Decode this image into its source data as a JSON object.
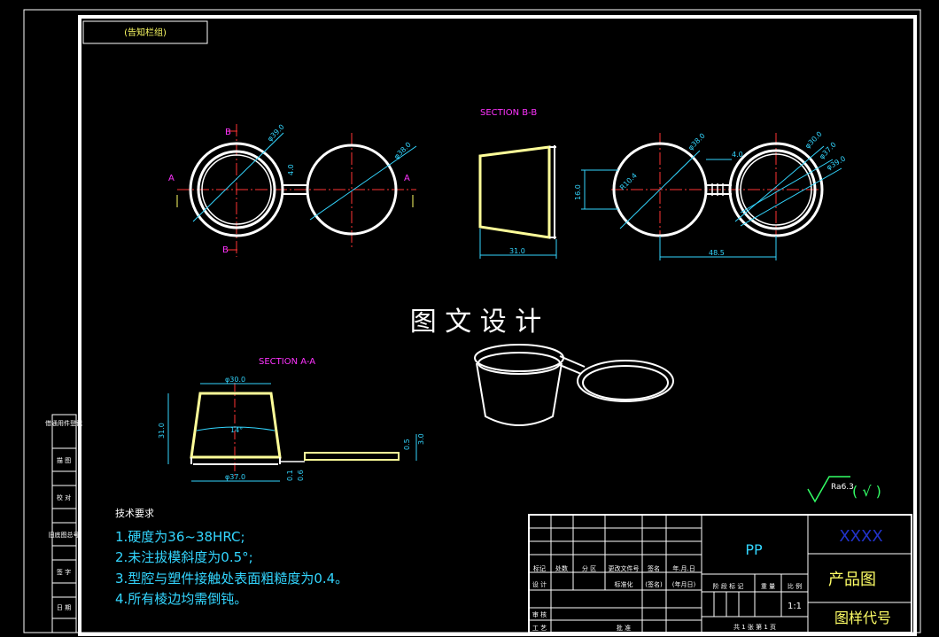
{
  "stamp_label": "(告知栏组)",
  "sections": {
    "bb": "SECTION B-B",
    "aa": "SECTION A-A"
  },
  "view_marks": {
    "A": "A",
    "B": "B"
  },
  "dimensions": {
    "top_d39": "φ39.0",
    "top_d38": "φ38.0",
    "top_4": "4.0",
    "bb_31": "31.0",
    "bb_16": "16.0",
    "bb_r104": "R10.4",
    "right_d38": "φ38.0",
    "right_4": "4.0",
    "right_d30": "φ30.0",
    "right_d37": "φ37.0",
    "right_d39": "φ39.0",
    "right_485": "48.5",
    "aa_d30": "φ30.0",
    "aa_31": "31.0",
    "aa_14": "14°",
    "aa_d37": "φ37.0",
    "aa_01": "0.1",
    "aa_06": "0.6",
    "aa_05": "0.5",
    "aa_30": "3.0"
  },
  "watermark": "图 文 设 计",
  "tech_notes": {
    "title": "技术要求",
    "items": [
      "1.硬度为36~38HRC;",
      "2.未注拔模斜度为0.5°;",
      "3.型腔与塑件接触处表面粗糙度为0.4。",
      "4.所有棱边均需倒钝。"
    ]
  },
  "roughness": {
    "value": "Ra6.3",
    "symbol": "( √ )"
  },
  "left_strip": [
    "借通用件登记",
    "旧底图总号",
    "底图总号",
    "签 字",
    "日 期"
  ],
  "left_strip_top": [
    "描 图",
    "校 对"
  ],
  "title_block": {
    "material": "PP",
    "company": "XXXX",
    "drawing_name": "产品图",
    "drawing_code": "图样代号",
    "headers": [
      "标记",
      "处数",
      "分 区",
      "更改文件号",
      "签名",
      "年.月.日"
    ],
    "row_design": [
      "设 计",
      "标准化",
      "(签名)",
      "(年月日)"
    ],
    "row_labels": [
      "审 核",
      "工 艺",
      "批 准"
    ],
    "stage_headers": [
      "阶 段 标 记",
      "重 量",
      "比 例"
    ],
    "scale": "1:1",
    "sheets": "共 1 张  第 1 页"
  }
}
